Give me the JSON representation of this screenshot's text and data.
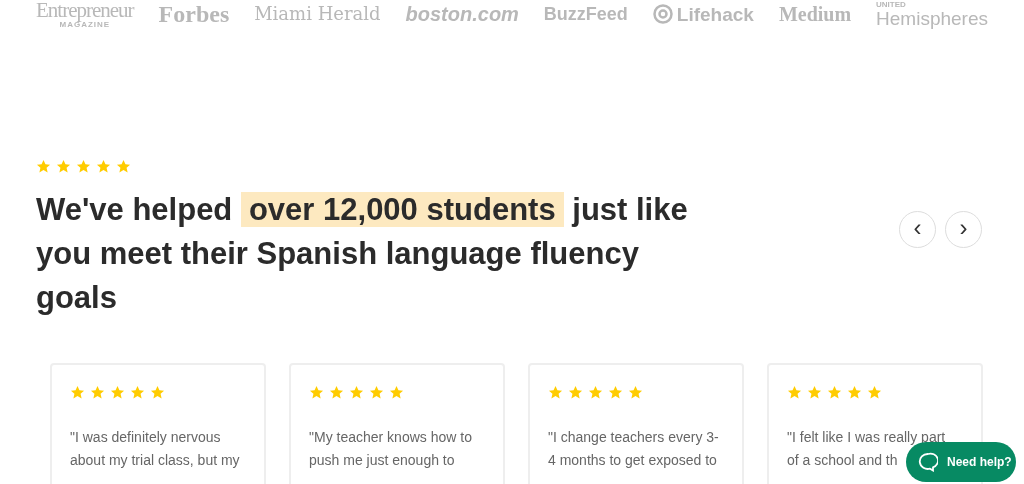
{
  "press_logos": [
    {
      "name": "Entrepreneur",
      "sub": "MAGAZINE"
    },
    {
      "name": "Forbes"
    },
    {
      "name": "Miami Herald"
    },
    {
      "name": "boston.com"
    },
    {
      "name": "BuzzFeed"
    },
    {
      "name": "Lifehack"
    },
    {
      "name": "Medium"
    },
    {
      "name": "Hemispheres",
      "super": "UNITED"
    }
  ],
  "hero": {
    "stars": 5,
    "heading": {
      "before": "We've helped",
      "highlight": "over 12,000 students",
      "after": "just like you meet their Spanish language fluency goals"
    },
    "prev": "‹",
    "next": "›"
  },
  "reviews": [
    {
      "stars": 5,
      "lines": [
        "\"I was definitely nervous",
        "about my trial class, but my"
      ]
    },
    {
      "stars": 5,
      "lines": [
        "\"My teacher knows how to",
        "push me just enough to"
      ]
    },
    {
      "stars": 5,
      "lines": [
        "\"I change teachers every 3-",
        "4 months to get exposed to"
      ]
    },
    {
      "stars": 5,
      "lines": [
        "\"I felt like I was really part",
        "of a school and th"
      ]
    }
  ],
  "help_button": {
    "label": "Need help?"
  }
}
